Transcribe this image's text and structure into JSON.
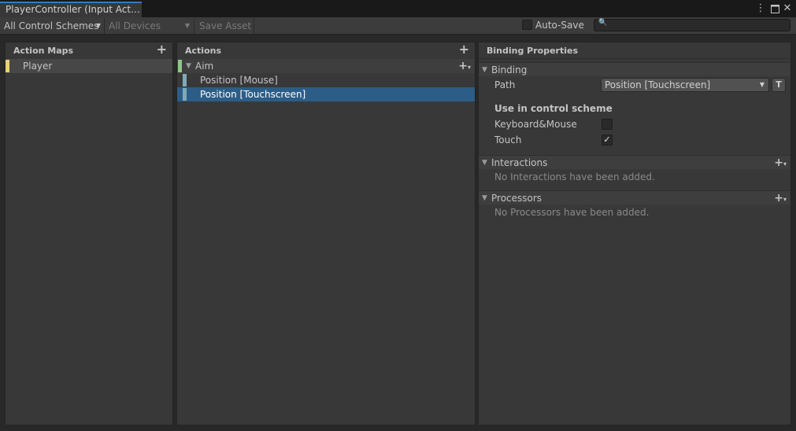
{
  "window": {
    "tab_title": "PlayerController (Input Act…",
    "menu_icon": "kebab-menu-icon",
    "maximize_icon": "maximize-icon",
    "close_icon": "close-icon"
  },
  "toolbar": {
    "control_schemes": "All Control Schemes",
    "devices": "All Devices",
    "save_asset": "Save Asset",
    "auto_save_label": "Auto-Save",
    "auto_save_checked": false,
    "search_placeholder": "",
    "search_icon": "search-icon"
  },
  "action_maps": {
    "header": "Action Maps",
    "items": [
      {
        "label": "Player",
        "color": "#e8d078",
        "selected": true
      }
    ]
  },
  "actions": {
    "header": "Actions",
    "action": {
      "label": "Aim",
      "color": "#8fc78a"
    },
    "bindings": [
      {
        "label": "Position [Mouse]",
        "color": "#7faab6",
        "selected": false
      },
      {
        "label": "Position [Touchscreen]",
        "color": "#7faab6",
        "selected": true
      }
    ]
  },
  "binding_properties": {
    "header": "Binding Properties",
    "binding_section": "Binding",
    "path_label": "Path",
    "path_value": "Position [Touchscreen]",
    "t_button": "T",
    "scheme_heading": "Use in control scheme",
    "schemes": [
      {
        "label": "Keyboard&Mouse",
        "checked": false
      },
      {
        "label": "Touch",
        "checked": true
      }
    ],
    "interactions_section": "Interactions",
    "interactions_empty": "No Interactions have been added.",
    "processors_section": "Processors",
    "processors_empty": "No Processors have been added."
  },
  "colors": {
    "accent_tab": "#3a79bb",
    "selection": "#2c5d87"
  }
}
